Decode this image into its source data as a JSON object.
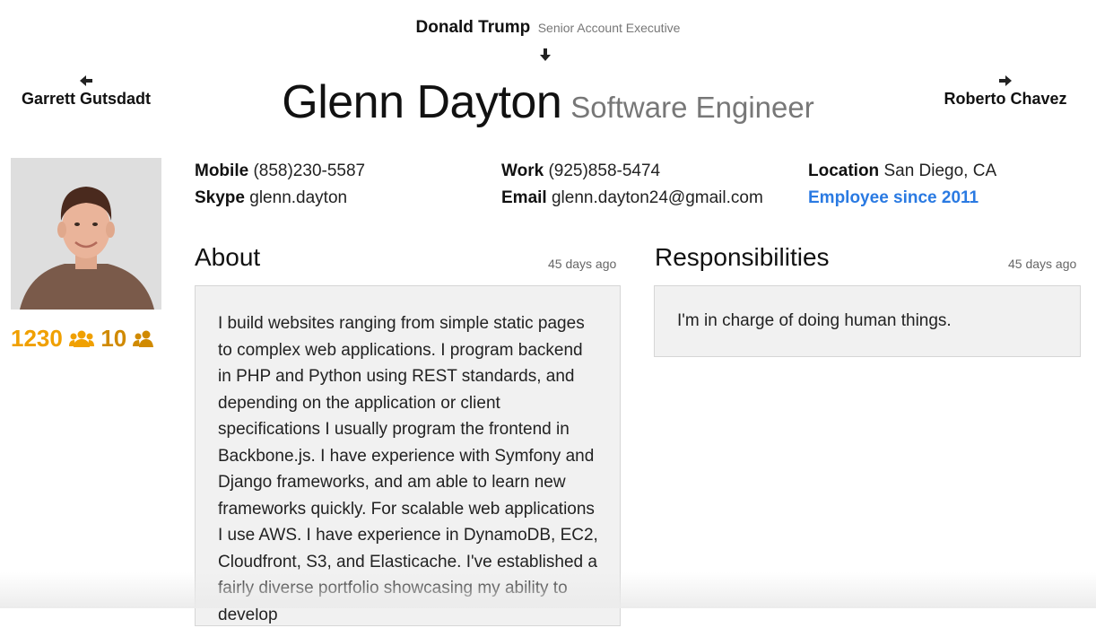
{
  "manager": {
    "name": "Donald Trump",
    "title": "Senior Account Executive"
  },
  "siblings": {
    "previous": {
      "name": "Garrett Gutsdadt",
      "arrow_icon": "arrow-left-icon"
    },
    "next": {
      "name": "Roberto Chavez",
      "arrow_icon": "arrow-right-icon"
    }
  },
  "profile": {
    "name": "Glenn Dayton",
    "title": "Software Engineer",
    "stats": {
      "followers": "1230",
      "followers_icon": "group-icon",
      "direct_reports": "10",
      "direct_reports_icon": "people-icon"
    }
  },
  "contact": {
    "mobile_label": "Mobile",
    "mobile": "(858)230-5587",
    "skype_label": "Skype",
    "skype": "glenn.dayton",
    "work_label": "Work",
    "work": "(925)858-5474",
    "email_label": "Email",
    "email": "glenn.dayton24@gmail.com",
    "location_label": "Location",
    "location": "San Diego, CA",
    "employee_since": "Employee since 2011"
  },
  "about": {
    "title": "About",
    "updated": "45 days ago",
    "text": "I build websites ranging from simple static pages to complex web applications. I program backend in PHP and Python using REST standards, and depending on the application or client specifications I usually program the frontend in Backbone.js. I have experience with Symfony and Django frameworks, and am able to learn new frameworks quickly. For scalable web applications I use AWS. I have experience in DynamoDB, EC2, Cloudfront, S3, and Elasticache. I've established a fairly diverse portfolio showcasing my ability to develop"
  },
  "responsibilities": {
    "title": "Responsibilities",
    "updated": "45 days ago",
    "text": "I'm in charge of doing human things."
  },
  "colors": {
    "accent_orange": "#f0a000",
    "link_blue": "#2a7ae2"
  }
}
